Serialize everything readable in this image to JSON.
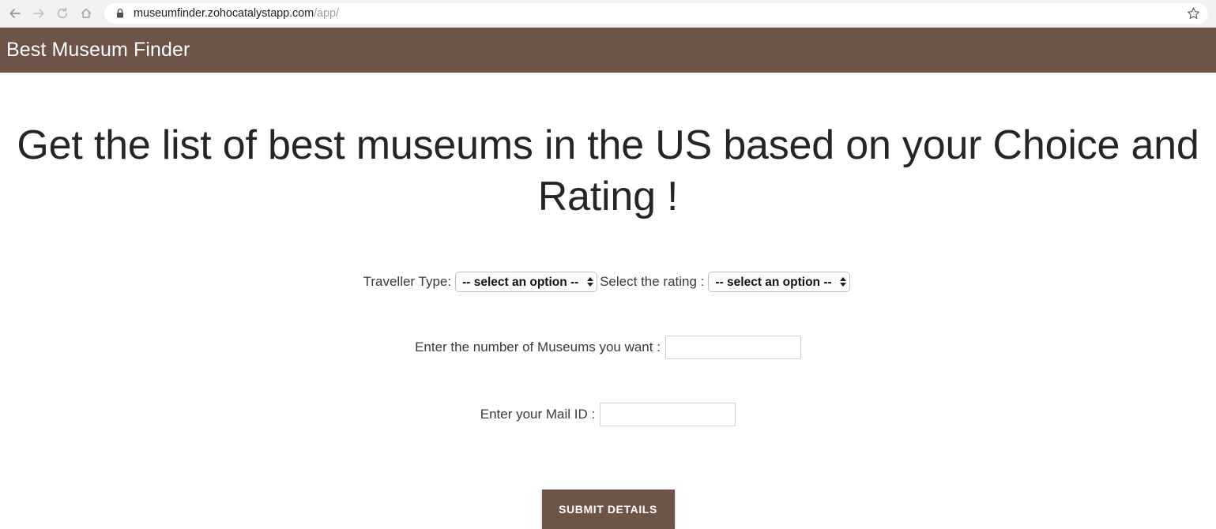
{
  "browser": {
    "nav": {
      "back": "back-arrow",
      "forward": "forward-arrow",
      "reload": "reload-arrow",
      "home": "home"
    },
    "omnibox": {
      "lock": "lock",
      "url_host": "museumfinder.zohocatalystapp.com",
      "url_path": "/app/",
      "bookmark": "star"
    }
  },
  "app": {
    "header_title": "Best Museum Finder",
    "brand_color": "#6e5349",
    "page_background": "#ffffff"
  },
  "main": {
    "hero_title": "Get the list of best museums in the US based on your Choice and Rating !",
    "traveller_type": {
      "label": "Traveller Type:",
      "selected": "-- select an option --",
      "options": [
        "-- select an option --"
      ]
    },
    "rating": {
      "label": "Select the rating :",
      "selected": "-- select an option --",
      "options": [
        "-- select an option --"
      ]
    },
    "museum_count": {
      "label": "Enter the number of Museums you want :",
      "value": "",
      "placeholder": ""
    },
    "mail_id": {
      "label": "Enter your Mail ID :",
      "value": "",
      "placeholder": ""
    },
    "submit": {
      "label": "SUBMIT DETAILS"
    }
  }
}
